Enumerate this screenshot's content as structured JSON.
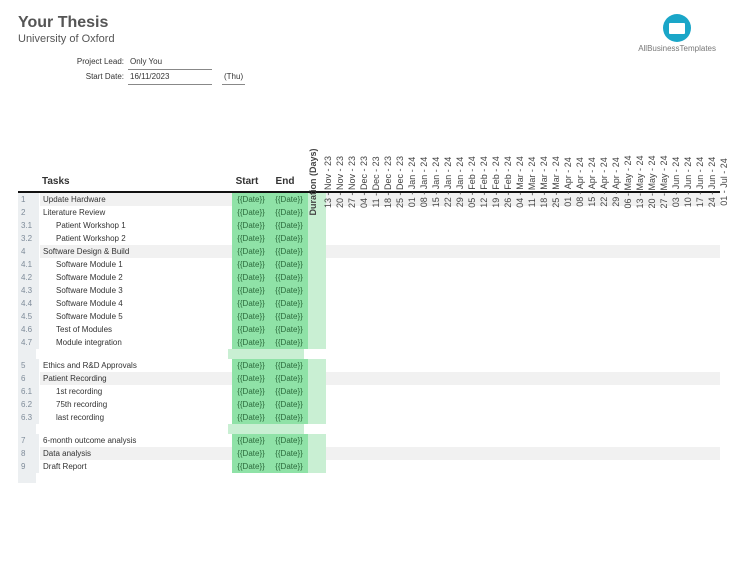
{
  "header": {
    "title": "Your Thesis",
    "subtitle": "University of Oxford",
    "logo_brand": "AllBusinessTemplates"
  },
  "meta": {
    "project_lead_label": "Project Lead:",
    "project_lead_value": "Only You",
    "start_date_label": "Start Date:",
    "start_date_value": "16/11/2023",
    "start_day": "(Thu)"
  },
  "columns": {
    "tasks": "Tasks",
    "start": "Start",
    "end": "End",
    "duration": "Duration (Days)"
  },
  "date_headers": [
    "13 - Nov - 23",
    "20 - Nov - 23",
    "27 - Nov - 23",
    "04 - Dec - 23",
    "11 - Dec - 23",
    "18 - Dec - 23",
    "25 - Dec - 23",
    "01 - Jan - 24",
    "08 - Jan - 24",
    "15 - Jan - 24",
    "22 - Jan - 24",
    "29 - Jan - 24",
    "05 - Feb - 24",
    "12 - Feb - 24",
    "19 - Feb - 24",
    "26 - Feb - 24",
    "04 - Mar - 24",
    "11 - Mar - 24",
    "18 - Mar - 24",
    "25 - Mar - 24",
    "01 - Apr - 24",
    "08 - Apr - 24",
    "15 - Apr - 24",
    "22 - Apr - 24",
    "29 - Apr - 24",
    "06 - May - 24",
    "13 - May - 24",
    "20 - May - 24",
    "27 - May - 24",
    "03 - Jun - 24",
    "10 - Jun - 24",
    "17 - Jun - 24",
    "24 - Jun - 24",
    "01 - Jul - 24"
  ],
  "groups": [
    {
      "rows": [
        {
          "num": "1",
          "task": "Update Hardware",
          "indent": false,
          "start": "{{Date}}",
          "end": "{{Date}}",
          "alt": true
        },
        {
          "num": "2",
          "task": "Literature Review",
          "indent": false,
          "start": "{{Date}}",
          "end": "{{Date}}",
          "alt": false
        },
        {
          "num": "3.1",
          "task": "Patient Workshop 1",
          "indent": true,
          "start": "{{Date}}",
          "end": "{{Date}}",
          "alt": false
        },
        {
          "num": "3.2",
          "task": "Patient Workshop 2",
          "indent": true,
          "start": "{{Date}}",
          "end": "{{Date}}",
          "alt": false
        },
        {
          "num": "4",
          "task": "Software Design & Build",
          "indent": false,
          "start": "{{Date}}",
          "end": "{{Date}}",
          "alt": true
        },
        {
          "num": "4.1",
          "task": "Software Module 1",
          "indent": true,
          "start": "{{Date}}",
          "end": "{{Date}}",
          "alt": false
        },
        {
          "num": "4.2",
          "task": "Software Module 2",
          "indent": true,
          "start": "{{Date}}",
          "end": "{{Date}}",
          "alt": false
        },
        {
          "num": "4.3",
          "task": "Software Module 3",
          "indent": true,
          "start": "{{Date}}",
          "end": "{{Date}}",
          "alt": false
        },
        {
          "num": "4.4",
          "task": "Software Module 4",
          "indent": true,
          "start": "{{Date}}",
          "end": "{{Date}}",
          "alt": false
        },
        {
          "num": "4.5",
          "task": "Software Module 5",
          "indent": true,
          "start": "{{Date}}",
          "end": "{{Date}}",
          "alt": false
        },
        {
          "num": "4.6",
          "task": "Test of Modules",
          "indent": true,
          "start": "{{Date}}",
          "end": "{{Date}}",
          "alt": false
        },
        {
          "num": "4.7",
          "task": "Module integration",
          "indent": true,
          "start": "{{Date}}",
          "end": "{{Date}}",
          "alt": false
        }
      ]
    },
    {
      "rows": [
        {
          "num": "5",
          "task": "Ethics and R&D Approvals",
          "indent": false,
          "start": "{{Date}}",
          "end": "{{Date}}",
          "alt": false
        },
        {
          "num": "6",
          "task": "Patient Recording",
          "indent": false,
          "start": "{{Date}}",
          "end": "{{Date}}",
          "alt": true
        },
        {
          "num": "6.1",
          "task": "1st recording",
          "indent": true,
          "start": "{{Date}}",
          "end": "{{Date}}",
          "alt": false
        },
        {
          "num": "6.2",
          "task": "75th recording",
          "indent": true,
          "start": "{{Date}}",
          "end": "{{Date}}",
          "alt": false
        },
        {
          "num": "6.3",
          "task": "last recording",
          "indent": true,
          "start": "{{Date}}",
          "end": "{{Date}}",
          "alt": false
        }
      ]
    },
    {
      "rows": [
        {
          "num": "7",
          "task": "6-month outcome analysis",
          "indent": false,
          "start": "{{Date}}",
          "end": "{{Date}}",
          "alt": false
        },
        {
          "num": "8",
          "task": "Data analysis",
          "indent": false,
          "start": "{{Date}}",
          "end": "{{Date}}",
          "alt": true
        },
        {
          "num": "9",
          "task": "Draft Report",
          "indent": false,
          "start": "{{Date}}",
          "end": "{{Date}}",
          "alt": false
        }
      ]
    }
  ]
}
